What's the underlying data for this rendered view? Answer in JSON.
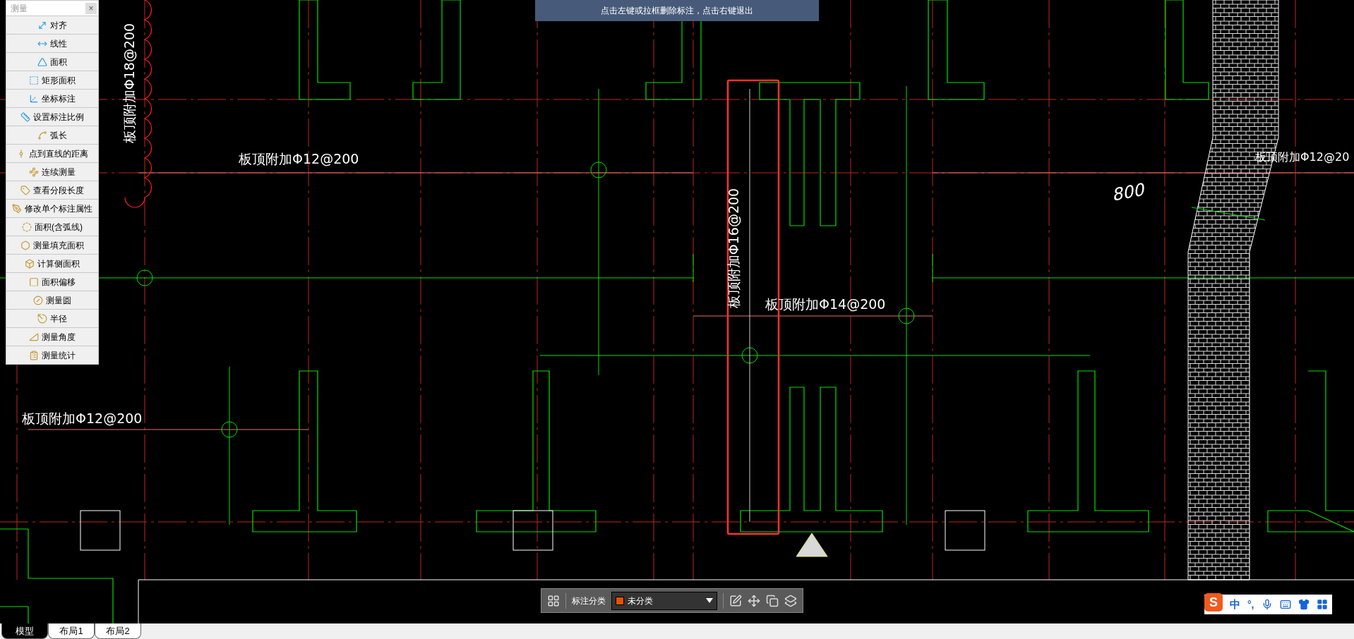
{
  "measure_panel": {
    "title": "测量",
    "close": "×",
    "items": [
      {
        "label": "对齐"
      },
      {
        "label": "线性"
      },
      {
        "label": "面积"
      },
      {
        "label": "矩形面积"
      },
      {
        "label": "坐标标注"
      },
      {
        "label": "设置标注比例"
      },
      {
        "label": "弧长"
      },
      {
        "label": "点到直线的距离"
      },
      {
        "label": "连续测量"
      },
      {
        "label": "查看分段长度"
      },
      {
        "label": "修改单个标注属性"
      },
      {
        "label": "面积(含弧线)"
      },
      {
        "label": "测量填充面积"
      },
      {
        "label": "计算侧面积"
      },
      {
        "label": "面积偏移"
      },
      {
        "label": "测量圆"
      },
      {
        "label": "半径"
      },
      {
        "label": "测量角度"
      },
      {
        "label": "测量统计"
      }
    ]
  },
  "prompt_banner": "点击左键或拉框删除标注，点击右键退出",
  "drawing": {
    "labels": [
      {
        "text": "板顶附加Φ18@200"
      },
      {
        "text": "板顶附加Φ12@200"
      },
      {
        "text": "板顶附加Φ16@200"
      },
      {
        "text": "板顶附加Φ14@200"
      },
      {
        "text": "板顶附加Φ12@200"
      },
      {
        "text": "板顶附加Φ12@20"
      },
      {
        "text": "800"
      }
    ]
  },
  "annotation_toolbar": {
    "label": "标注分类",
    "category": "未分类"
  },
  "layout_tabs": [
    {
      "label": "模型",
      "selected": true
    },
    {
      "label": "布局1",
      "selected": false
    },
    {
      "label": "布局2",
      "selected": false
    }
  ],
  "ime_bar": {
    "logo": "S",
    "mode": "中",
    "punctuation": "°,"
  }
}
